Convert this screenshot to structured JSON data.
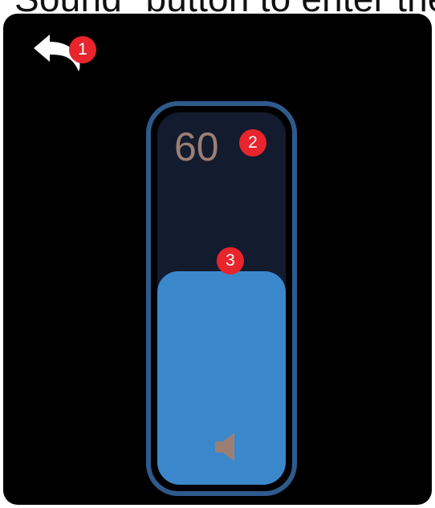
{
  "caption": {
    "text": "Sound\" button to enter the"
  },
  "screen": {
    "back_button": {
      "icon": "back-arrow-icon",
      "color": "#ffffff"
    },
    "volume_slider": {
      "value_label": "60",
      "level": 0.6,
      "fill_color": "#3b87cc",
      "track_color": "#131b2f",
      "border_color": "#2e5a8c",
      "value_color": "#9c7f72",
      "icon": "speaker-icon"
    }
  },
  "annotations": [
    {
      "label": "1"
    },
    {
      "label": "2"
    },
    {
      "label": "3"
    }
  ],
  "badge_color": "#e8242c"
}
